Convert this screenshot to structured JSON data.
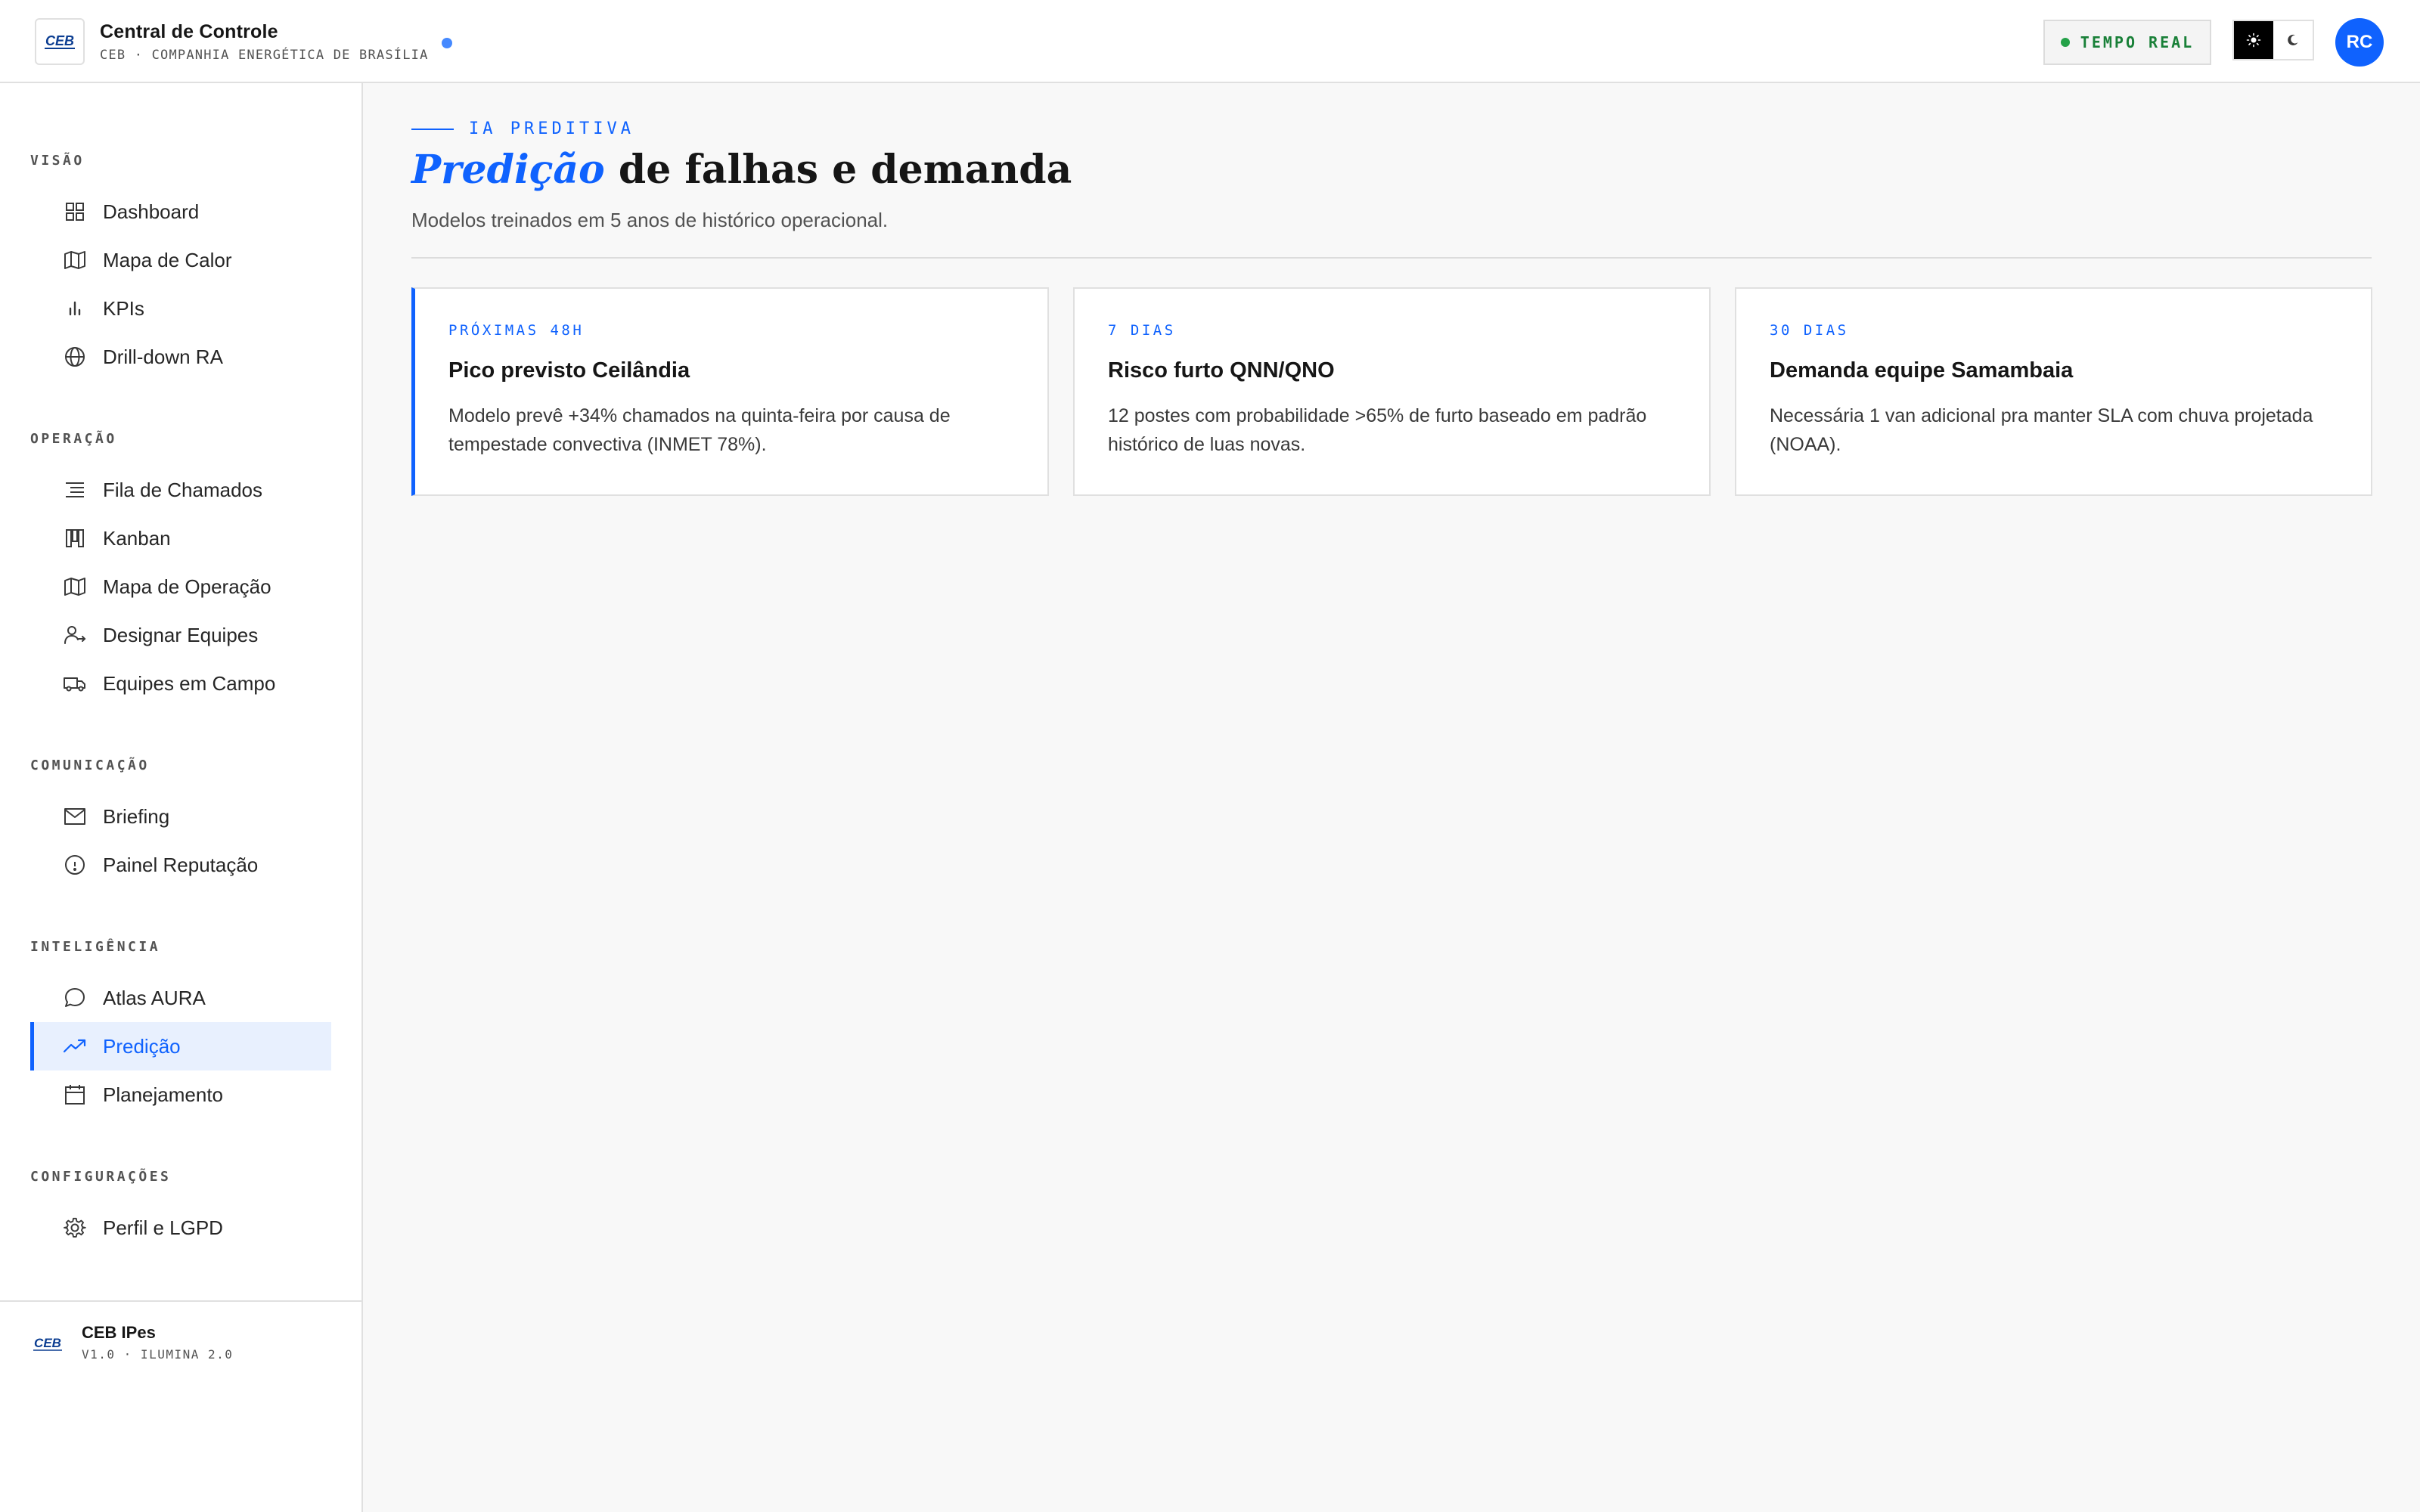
{
  "header": {
    "logo_text": "CEB",
    "title": "Central de Controle",
    "subtitle": "CEB · COMPANHIA ENERGÉTICA DE BRASÍLIA",
    "live_label": "TEMPO REAL",
    "avatar_initials": "RC",
    "theme_options": [
      "sun-icon",
      "moon-icon"
    ],
    "theme_selected": "light"
  },
  "sidebar": {
    "sections": [
      {
        "label": "VISÃO",
        "items": [
          {
            "label": "Dashboard",
            "icon": "grid-icon"
          },
          {
            "label": "Mapa de Calor",
            "icon": "map-icon"
          },
          {
            "label": "KPIs",
            "icon": "bar-chart-icon"
          },
          {
            "label": "Drill-down RA",
            "icon": "globe-icon"
          }
        ]
      },
      {
        "label": "OPERAÇÃO",
        "items": [
          {
            "label": "Fila de Chamados",
            "icon": "list-icon"
          },
          {
            "label": "Kanban",
            "icon": "kanban-icon"
          },
          {
            "label": "Mapa de Operação",
            "icon": "map-icon"
          },
          {
            "label": "Designar Equipes",
            "icon": "user-assign-icon"
          },
          {
            "label": "Equipes em Campo",
            "icon": "truck-icon"
          }
        ]
      },
      {
        "label": "COMUNICAÇÃO",
        "items": [
          {
            "label": "Briefing",
            "icon": "mail-icon"
          },
          {
            "label": "Painel Reputação",
            "icon": "info-circle-icon"
          }
        ]
      },
      {
        "label": "INTELIGÊNCIA",
        "items": [
          {
            "label": "Atlas AURA",
            "icon": "chat-icon"
          },
          {
            "label": "Predição",
            "icon": "trend-icon",
            "active": true
          },
          {
            "label": "Planejamento",
            "icon": "calendar-icon"
          }
        ]
      },
      {
        "label": "CONFIGURAÇÕES",
        "items": [
          {
            "label": "Perfil e LGPD",
            "icon": "gear-icon"
          }
        ]
      }
    ],
    "footer": {
      "title": "CEB IPes",
      "subtitle": "V1.0 · ILUMINA 2.0"
    }
  },
  "main": {
    "eyebrow": "IA PREDITIVA",
    "title_accent": "Predição",
    "title_rest": " de falhas e demanda",
    "subtitle": "Modelos treinados em 5 anos de histórico operacional.",
    "cards": [
      {
        "tag": "PRÓXIMAS 48H",
        "title": "Pico previsto Ceilândia",
        "body": "Modelo prevê +34% chamados na quinta-feira por causa de tempestade convectiva (INMET 78%).",
        "highlight": true
      },
      {
        "tag": "7 DIAS",
        "title": "Risco furto QNN/QNO",
        "body": "12 postes com probabilidade >65% de furto baseado em padrão histórico de luas novas."
      },
      {
        "tag": "30 DIAS",
        "title": "Demanda equipe Samambaia",
        "body": "Necessária 1 van adicional pra manter SLA com chuva projetada (NOAA)."
      }
    ]
  },
  "colors": {
    "accent": "#0f62fe",
    "live": "#24a148",
    "background": "#f8f8f8"
  }
}
